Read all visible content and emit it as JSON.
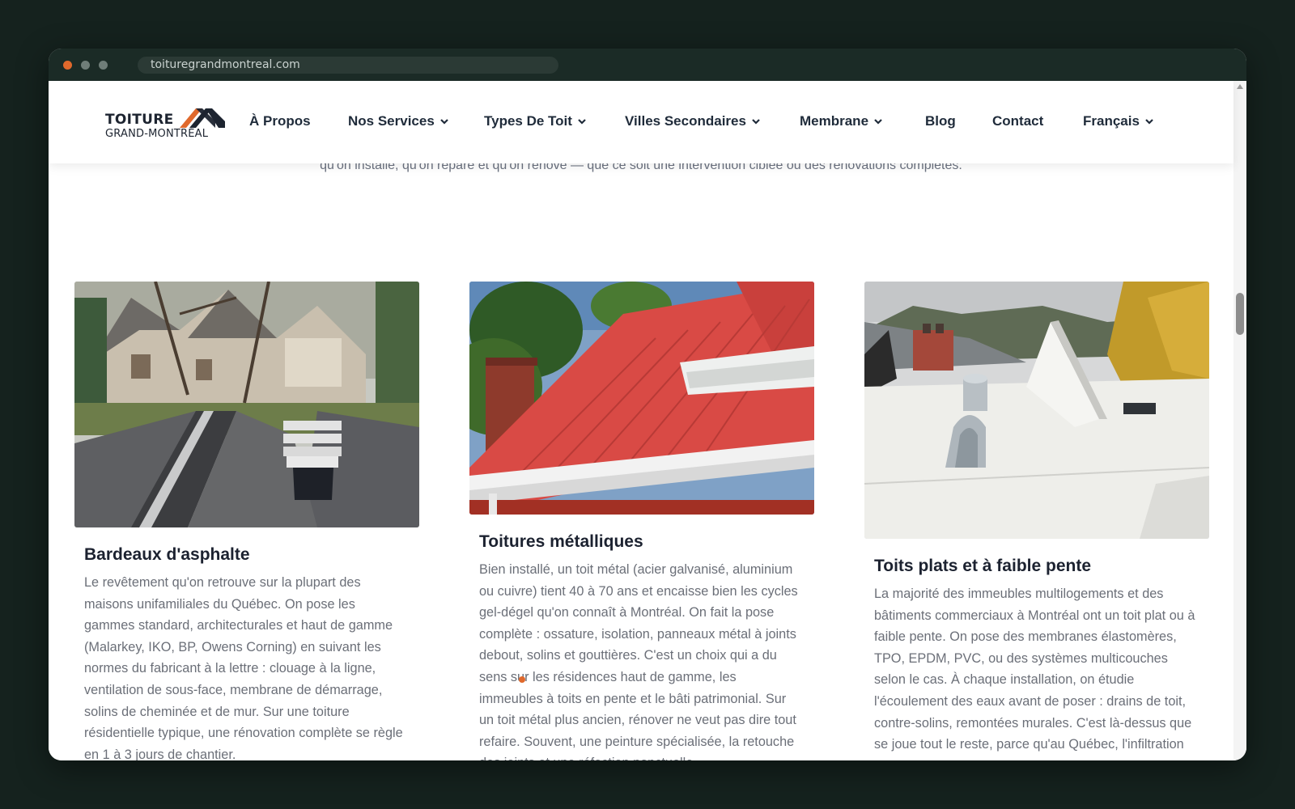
{
  "browser": {
    "url": "toituregrandmontreal.com"
  },
  "logo": {
    "line1": "TOITURE",
    "line2": "GRAND-MONTRÉAL",
    "accent_color": "#e0692c"
  },
  "nav": {
    "items": [
      {
        "label": "À Propos",
        "dropdown": false
      },
      {
        "label": "Nos Services",
        "dropdown": true
      },
      {
        "label": "Types De Toit",
        "dropdown": true
      },
      {
        "label": "Villes Secondaires",
        "dropdown": true
      },
      {
        "label": "Membrane",
        "dropdown": true
      },
      {
        "label": "Blog",
        "dropdown": false
      },
      {
        "label": "Contact",
        "dropdown": false
      },
      {
        "label": "Français",
        "dropdown": true
      }
    ]
  },
  "intro": {
    "text": "qu'on installe, qu'on répare et qu'on rénove — que ce soit une intervention ciblée ou des rénovations complètes."
  },
  "cards": [
    {
      "title": "Bardeaux d'asphalte",
      "body": "Le revêtement qu'on retrouve sur la plupart des maisons unifamiliales du Québec. On pose les gammes standard, architecturales et haut de gamme (Malarkey, IKO, BP, Owens Corning) en suivant les normes du fabricant à la lettre : clouage à la ligne, ventilation de sous-face, membrane de démarrage, solins de cheminée et de mur. Sur une toiture résidentielle typique, une rénovation complète se règle en 1 à 3 jours de chantier."
    },
    {
      "title": "Toitures métalliques",
      "body": "Bien installé, un toit métal (acier galvanisé, aluminium ou cuivre) tient 40 à 70 ans et encaisse bien les cycles gel-dégel qu'on connaît à Montréal. On fait la pose complète : ossature, isolation, panneaux métal à joints debout, solins et gouttières. C'est un choix qui a du sens sur les résidences haut de gamme, les immeubles à toits en pente et le bâti patrimonial. Sur un toit métal plus ancien, rénover ne veut pas dire tout refaire. Souvent, une peinture spécialisée, la retouche des joints et une réfection ponctuelle"
    },
    {
      "title": "Toits plats et à faible pente",
      "body": "La majorité des immeubles multilogements et des bâtiments commerciaux à Montréal ont un toit plat ou à faible pente. On pose des membranes élastomères, TPO, EPDM, PVC, ou des systèmes multicouches selon le cas. À chaque installation, on étudie l'écoulement des eaux avant de poser : drains de toit, contre-solins, remontées murales. C'est là-dessus que se joue tout le reste, parce qu'au Québec, l'infiltration d'eau reste la première cause de"
    }
  ]
}
